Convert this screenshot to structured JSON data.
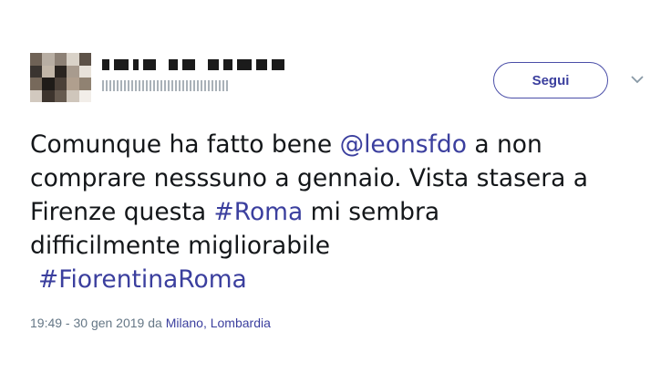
{
  "profile": {
    "avatar_colors": [
      "#6f6256",
      "#b8aea3",
      "#8d8176",
      "#d9d2c8",
      "#5d5248",
      "#3a3430",
      "#c2b6a8",
      "#2a2420",
      "#a89b8e",
      "#e8e2da",
      "#77695b",
      "#1f1b18",
      "#4b4038",
      "#b09f8e",
      "#908272",
      "#d2c9bf",
      "#3d342d",
      "#665a4f",
      "#cfc6bb",
      "#f2eee9"
    ]
  },
  "actions": {
    "follow_label": "Segui",
    "more_icon": "chevron-down-icon"
  },
  "tweet": {
    "line1_pre": "Comunque ha fatto bene ",
    "mention": "@leonsfdo",
    "line1_post": " a non",
    "line2": "comprare nesssuno a gennaio. Vista stasera a",
    "line3_pre": "Firenze questa ",
    "hashtag1": "#Roma",
    "line3_post": " mi sembra",
    "line4": "difficilmente migliorabile",
    "hashtag2": "#FiorentinaRoma"
  },
  "meta": {
    "timestamp": "19:49 - 30 gen 2019",
    "from": " da ",
    "location": "Milano, Lombardia"
  },
  "colors": {
    "link": "#3b3f9e",
    "text": "#14171a",
    "secondary": "#657786"
  }
}
